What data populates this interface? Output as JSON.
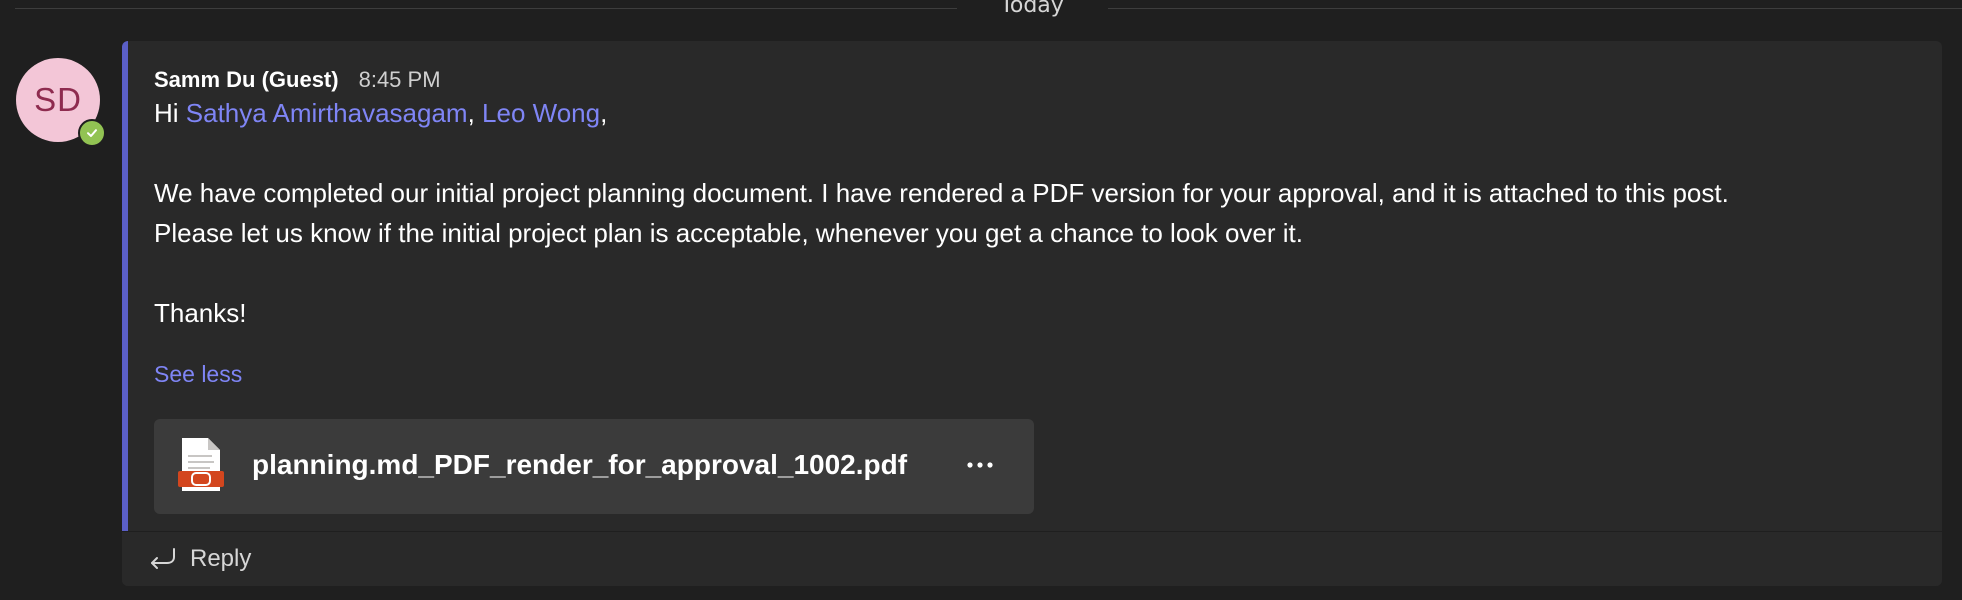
{
  "divider": {
    "label": "Today"
  },
  "message": {
    "avatar_initials": "SD",
    "presence": "available",
    "sender": "Samm Du (Guest)",
    "timestamp": "8:45 PM",
    "greeting_prefix": "Hi ",
    "mentions": [
      "Sathya Amirthavasagam",
      "Leo Wong"
    ],
    "mention_separator": ", ",
    "greeting_suffix": ",",
    "paragraph_line1": "We have completed our initial project planning document. I have rendered a PDF version for your approval, and it is attached to this post.",
    "paragraph_line2": "Please let us know if the initial project plan is acceptable, whenever you get a chance to look over it.",
    "signoff": "Thanks!",
    "see_less_label": "See less"
  },
  "attachment": {
    "file_name": "planning.md_PDF_render_for_approval_1002.pdf",
    "icon": "pdf-file-icon",
    "more_label": "···"
  },
  "reply": {
    "label": "Reply",
    "icon": "reply-arrow-icon"
  },
  "colors": {
    "background": "#1f1f1f",
    "card": "#292929",
    "accent": "#5b5fc7",
    "mention": "#7f85f5",
    "attachment_bg": "#3b3b3b",
    "presence_green": "#92c353",
    "avatar_bg": "#f3c6d7",
    "avatar_text": "#8e2b4f"
  }
}
